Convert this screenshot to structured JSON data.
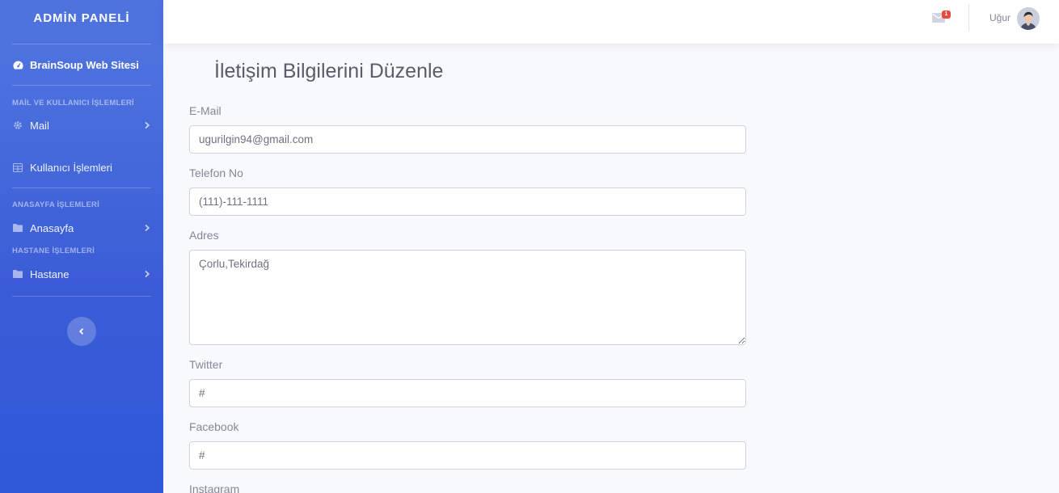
{
  "sidebar": {
    "brand": "ADMİN PANELİ",
    "site_link": "BrainSoup Web Sitesi",
    "headings": {
      "mail_users": "MAİL VE KULLANICI İŞLEMLERİ",
      "homepage": "ANASAYFA İŞLEMLERİ",
      "hospital": "HASTANE İŞLEMLERİ"
    },
    "items": {
      "mail": "Mail",
      "users": "Kullanıcı İşlemleri",
      "homepage": "Anasayfa",
      "hospital": "Hastane"
    }
  },
  "topbar": {
    "message_count": "1",
    "user_name": "Uğur"
  },
  "main": {
    "title": "İletişim Bilgilerini Düzenle",
    "fields": {
      "email": {
        "label": "E-Mail",
        "value": "ugurilgin94@gmail.com"
      },
      "phone": {
        "label": "Telefon No",
        "value": "(111)-111-1111"
      },
      "address": {
        "label": "Adres",
        "value": "Çorlu,Tekirdağ"
      },
      "twitter": {
        "label": "Twitter",
        "value": "#"
      },
      "facebook": {
        "label": "Facebook",
        "value": "#"
      },
      "instagram": {
        "label": "Instagram"
      }
    }
  },
  "colors": {
    "sidebar_primary": "#4e73df",
    "badge": "#e74a3b",
    "page_bg": "#f8f9fc"
  }
}
